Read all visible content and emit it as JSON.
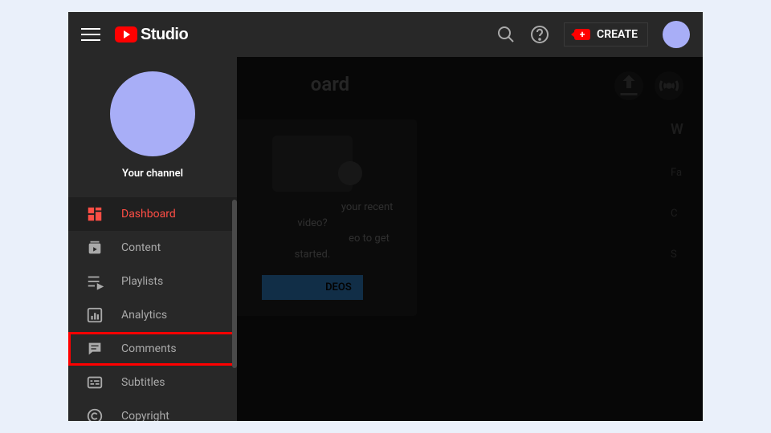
{
  "header": {
    "logo_text": "Studio",
    "create_label": "CREATE"
  },
  "sidebar": {
    "channel_label": "Your channel",
    "items": [
      {
        "label": "Dashboard",
        "icon": "dashboard-icon",
        "active": true
      },
      {
        "label": "Content",
        "icon": "content-icon"
      },
      {
        "label": "Playlists",
        "icon": "playlists-icon"
      },
      {
        "label": "Analytics",
        "icon": "analytics-icon"
      },
      {
        "label": "Comments",
        "icon": "comments-icon",
        "highlighted": true
      },
      {
        "label": "Subtitles",
        "icon": "subtitles-icon"
      },
      {
        "label": "Copyright",
        "icon": "copyright-icon"
      }
    ]
  },
  "main": {
    "page_title_fragment": "oard",
    "card_line1": "your recent video?",
    "card_line2": "eo to get started.",
    "upload_button_fragment": "DEOS",
    "right_hints": [
      "W",
      "Fa",
      "C",
      "S"
    ]
  }
}
